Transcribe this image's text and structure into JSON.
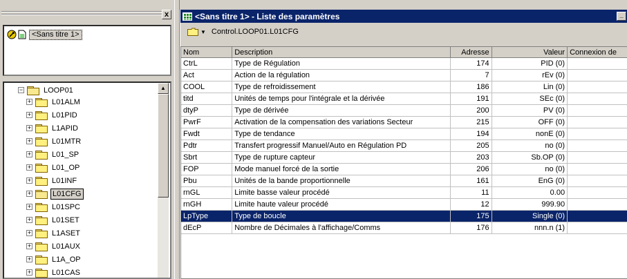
{
  "project": {
    "label": "<Sans titre 1>"
  },
  "left_panel": {
    "close_label": "x"
  },
  "tree": {
    "root": "LOOP01",
    "items": [
      {
        "label": "L01ALM"
      },
      {
        "label": "L01PID"
      },
      {
        "label": "L1APID"
      },
      {
        "label": "L01MTR"
      },
      {
        "label": "L01_SP"
      },
      {
        "label": "L01_OP"
      },
      {
        "label": "L01INF"
      },
      {
        "label": "L01CFG",
        "selected": true
      },
      {
        "label": "L01SPC"
      },
      {
        "label": "L01SET"
      },
      {
        "label": "L1ASET"
      },
      {
        "label": "L01AUX"
      },
      {
        "label": "L1A_OP"
      },
      {
        "label": "L01CAS"
      }
    ]
  },
  "window": {
    "title": "<Sans titre 1> - Liste des paramètres",
    "path": "Control.LOOP01.L01CFG"
  },
  "table": {
    "columns": [
      "Nom",
      "Description",
      "Adresse",
      "Valeur",
      "Connexion de"
    ],
    "rows": [
      {
        "nom": "CtrL",
        "desc": "Type de Régulation",
        "addr": "174",
        "val": "PID (0)"
      },
      {
        "nom": "Act",
        "desc": "Action de la régulation",
        "addr": "7",
        "val": "rEv (0)"
      },
      {
        "nom": "COOL",
        "desc": "Type de refroidissement",
        "addr": "186",
        "val": "Lin (0)"
      },
      {
        "nom": "titd",
        "desc": "Unités de temps pour l'intégrale et la dérivée",
        "addr": "191",
        "val": "SEc (0)"
      },
      {
        "nom": "dtyP",
        "desc": "Type de dérivée",
        "addr": "200",
        "val": "PV (0)"
      },
      {
        "nom": "PwrF",
        "desc": "Activation de la compensation des variations Secteur",
        "addr": "215",
        "val": "OFF (0)"
      },
      {
        "nom": "Fwdt",
        "desc": "Type de tendance",
        "addr": "194",
        "val": "nonE (0)"
      },
      {
        "nom": "Pdtr",
        "desc": "Transfert progressif  Manuel/Auto en Régulation PD",
        "addr": "205",
        "val": "no (0)"
      },
      {
        "nom": "Sbrt",
        "desc": "Type de rupture capteur",
        "addr": "203",
        "val": "Sb.OP (0)"
      },
      {
        "nom": "FOP",
        "desc": "Mode manuel forcé de la sortie",
        "addr": "206",
        "val": "no (0)"
      },
      {
        "nom": "Pbu",
        "desc": "Unités de la bande proportionnelle",
        "addr": "161",
        "val": "EnG (0)"
      },
      {
        "nom": "rnGL",
        "desc": "Limite basse valeur procédé",
        "addr": "11",
        "val": "0.00"
      },
      {
        "nom": "rnGH",
        "desc": "Limite haute valeur procédé",
        "addr": "12",
        "val": "999.90"
      },
      {
        "nom": "LpType",
        "desc": "Type de boucle",
        "addr": "175",
        "val": "Single (0)",
        "selected": true
      },
      {
        "nom": "dEcP",
        "desc": "Nombre de Décimales à l'affichage/Comms",
        "addr": "176",
        "val": "nnn.n (1)"
      }
    ]
  }
}
